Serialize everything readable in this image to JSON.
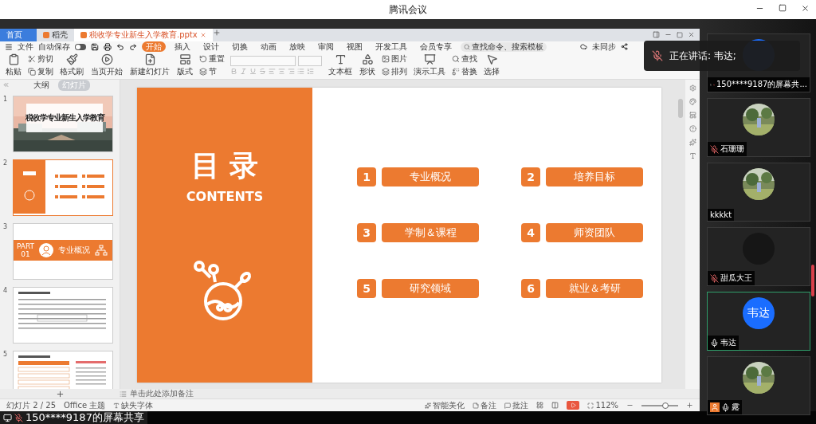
{
  "window": {
    "title": "腾讯会议"
  },
  "wps": {
    "tabs": [
      {
        "label": "首页",
        "kind": "home",
        "selected": false
      },
      {
        "label": "稻壳",
        "kind": "docer",
        "selected": false
      },
      {
        "label": "税收学专业新生入学教育.pptx",
        "kind": "file",
        "selected": true
      }
    ],
    "menu": {
      "file": "文件",
      "autosave": {
        "label": "自动保存",
        "on": false
      },
      "items": [
        {
          "label": "开始",
          "selected": true
        },
        {
          "label": "插入",
          "selected": false
        },
        {
          "label": "设计",
          "selected": false
        },
        {
          "label": "切换",
          "selected": false
        },
        {
          "label": "动画",
          "selected": false
        },
        {
          "label": "放映",
          "selected": false
        },
        {
          "label": "审阅",
          "selected": false
        },
        {
          "label": "视图",
          "selected": false
        },
        {
          "label": "开发工具",
          "selected": false
        },
        {
          "label": "会员专享",
          "selected": false
        }
      ],
      "search": "查找命令、搜索模板",
      "sync": "未同步"
    },
    "toolbar": [
      {
        "kind": "large",
        "label": "粘贴"
      },
      {
        "kind": "stack",
        "labels": [
          "剪切",
          "复制"
        ]
      },
      {
        "kind": "large",
        "label": "格式刷"
      },
      {
        "kind": "large",
        "label": "当页开始"
      },
      {
        "kind": "large",
        "label": "新建幻灯片"
      },
      {
        "kind": "large",
        "label": "版式"
      },
      {
        "kind": "stack",
        "labels": [
          "重置",
          "节"
        ]
      },
      {
        "kind": "font"
      },
      {
        "kind": "large",
        "label": "文本框"
      },
      {
        "kind": "large",
        "label": "形状"
      },
      {
        "kind": "stack",
        "labels": [
          "图片",
          "排列"
        ]
      },
      {
        "kind": "large",
        "label": "演示工具"
      },
      {
        "kind": "stack",
        "labels": [
          "查找",
          "替换"
        ]
      },
      {
        "kind": "large",
        "label": "选择"
      }
    ],
    "panel": {
      "tabs": [
        {
          "label": "大纲",
          "selected": false
        },
        {
          "label": "幻灯片",
          "selected": true
        }
      ],
      "slides": [
        {
          "number": "1",
          "kind": "cover",
          "title": "税收学专业新生入学教育",
          "selected": false
        },
        {
          "number": "2",
          "kind": "contents",
          "selected": true
        },
        {
          "number": "3",
          "kind": "section",
          "part": "PART",
          "part_number": "01",
          "title": "专业概况",
          "selected": false
        },
        {
          "number": "4",
          "kind": "document",
          "selected": false
        },
        {
          "number": "5",
          "kind": "table",
          "selected": false
        }
      ]
    },
    "slide": {
      "title": "目 录",
      "subtitle": "CONTENTS",
      "items": [
        {
          "number": "1",
          "label": "专业概况"
        },
        {
          "number": "2",
          "label": "培养目标"
        },
        {
          "number": "3",
          "label": "学制＆课程"
        },
        {
          "number": "4",
          "label": "师资团队"
        },
        {
          "number": "5",
          "label": "研究领域"
        },
        {
          "number": "6",
          "label": "就业＆考研"
        }
      ]
    },
    "notes": {
      "placeholder": "单击此处添加备注"
    },
    "status": {
      "slide": "幻灯片 2 / 25",
      "theme": "Office 主题",
      "fonts": "缺失字体",
      "beautify": "智能美化",
      "notes": "备注",
      "comments": "批注",
      "zoom": "112%",
      "level": 0.65
    }
  },
  "toast": {
    "text": "正在讲话: 韦达;"
  },
  "participants": [
    {
      "name": "150****9187的屏幕共...",
      "avatar": {
        "kind": "blank",
        "color": "#1a6dff"
      },
      "sharing": true,
      "host": false,
      "muted": true,
      "speaking": false
    },
    {
      "name": "石珊珊",
      "sharing": false,
      "host": false,
      "muted": true,
      "speaking": false
    },
    {
      "name": "kkkkt",
      "sharing": false,
      "host": false,
      "speaking": false
    },
    {
      "name": "甜瓜大王",
      "avatar": {
        "kind": "blank",
        "color": "#161616"
      },
      "sharing": false,
      "host": false,
      "muted": true,
      "speaking": false
    },
    {
      "name": "韦达",
      "avatar": {
        "kind": "initials",
        "initials": "韦达"
      },
      "sharing": false,
      "host": false,
      "muted": false,
      "speaking": true
    },
    {
      "name": "露",
      "sharing": false,
      "host": true,
      "muted": false,
      "speaking": false
    }
  ],
  "share_bar": {
    "label": "150****9187的屏幕共享"
  }
}
